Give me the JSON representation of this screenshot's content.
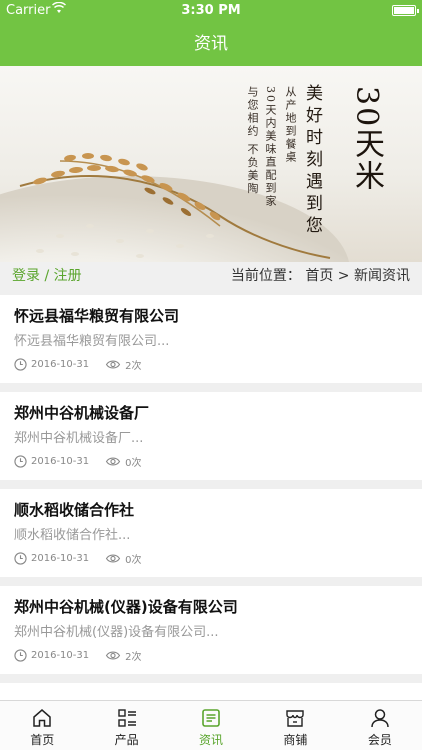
{
  "status": {
    "carrier": "Carrier",
    "time": "3:30 PM"
  },
  "nav": {
    "title": "资讯"
  },
  "banner": {
    "big_text": "30天米",
    "line_main": "美好时刻遇到您",
    "line_a": "从产地到餐桌",
    "line_b": "30天内美味直配到家",
    "line_c": "与您相约 不负美陶"
  },
  "location": {
    "login": "登录",
    "separator": " / ",
    "register": "注册",
    "breadcrumb": "当前位置： 首页 > 新闻资讯"
  },
  "articles": [
    {
      "title": "怀远县福华粮贸有限公司",
      "summary": "怀远县福华粮贸有限公司...",
      "date": "2016-10-31",
      "views": "2次"
    },
    {
      "title": "郑州中谷机械设备厂",
      "summary": "郑州中谷机械设备厂...",
      "date": "2016-10-31",
      "views": "0次"
    },
    {
      "title": "顺水稻收储合作社",
      "summary": "顺水稻收储合作社...",
      "date": "2016-10-31",
      "views": "0次"
    },
    {
      "title": "郑州中谷机械(仪器)设备有限公司",
      "summary": "郑州中谷机械(仪器)设备有限公司...",
      "date": "2016-10-31",
      "views": "2次"
    }
  ],
  "tabs": [
    {
      "label": "首页",
      "icon": "home-icon",
      "active": false
    },
    {
      "label": "产品",
      "icon": "list-icon",
      "active": false
    },
    {
      "label": "资讯",
      "icon": "news-icon",
      "active": true
    },
    {
      "label": "商铺",
      "icon": "shop-icon",
      "active": false
    },
    {
      "label": "会员",
      "icon": "user-icon",
      "active": false
    }
  ],
  "colors": {
    "brand": "#72c443",
    "accent_text": "#5aa52d",
    "muted": "#999999"
  }
}
